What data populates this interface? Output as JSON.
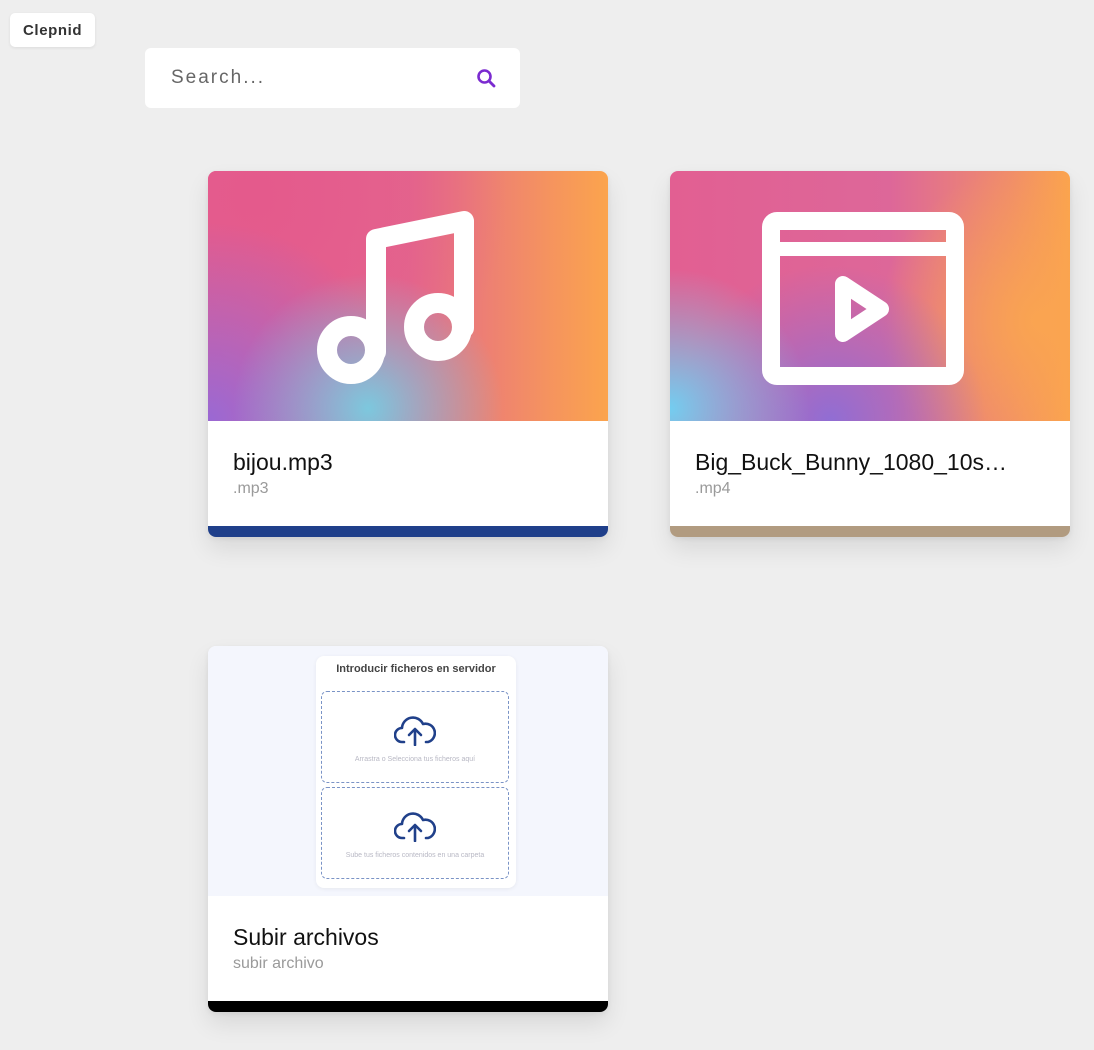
{
  "app": {
    "brand": "Clepnid"
  },
  "search": {
    "placeholder": "Search..."
  },
  "colors": {
    "accent": "#7b2bd0",
    "bar_mp3": "#1f3f8a",
    "bar_mp4": "#b19b80",
    "bar_upload": "#000000"
  },
  "cards": [
    {
      "title": "bijou.mp3",
      "subtitle": ".mp3",
      "icon": "music-note-icon"
    },
    {
      "title": "Big_Buck_Bunny_1080_10s…",
      "subtitle": ".mp4",
      "icon": "video-player-icon"
    },
    {
      "title": "Subir archivos",
      "subtitle": "subir archivo",
      "icon": "upload-preview"
    }
  ],
  "upload_preview": {
    "title": "Introducir ficheros en servidor",
    "dropzones": [
      {
        "text": "Arrastra o Selecciona tus ficheros aquí",
        "icon": "cloud-upload-icon"
      },
      {
        "text": "Sube tus ficheros contenidos en una carpeta",
        "icon": "cloud-upload-icon"
      }
    ]
  }
}
